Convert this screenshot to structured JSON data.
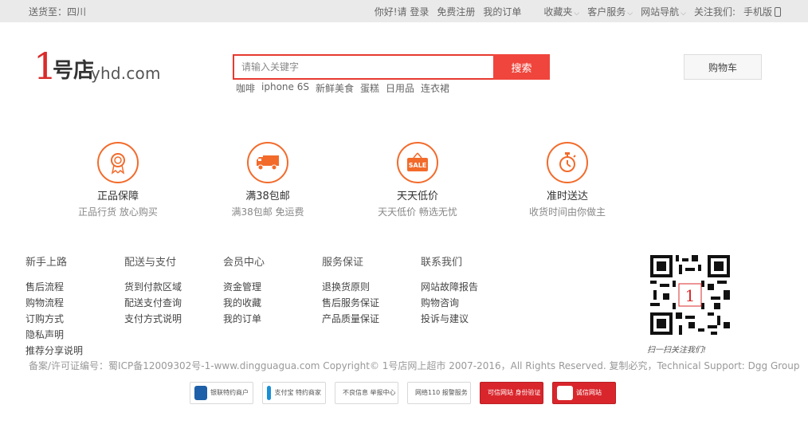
{
  "topbar": {
    "location": "送货至：四川",
    "greeting": "你好!请",
    "login": "登录",
    "register": "免费注册",
    "my_orders": "我的订单",
    "favorites": "收藏夹",
    "customer_service": "客户服务",
    "site_nav": "网站导航",
    "follow_us": "关注我们:",
    "mobile": "手机版"
  },
  "header": {
    "logo_digit": "1",
    "logo_char": "号店",
    "logo_domain": "yhd.com",
    "search_placeholder": "请输入关键字",
    "search_button": "搜索",
    "hotwords": [
      "咖啡",
      "iphone 6S",
      "新鲜美食",
      "蛋糕",
      "日用品",
      "连衣裙"
    ],
    "cart_label": "购物车"
  },
  "services": [
    {
      "title": "正品保障",
      "sub": "正品行货 放心购买",
      "icon": "certificate-icon"
    },
    {
      "title": "满38包邮",
      "sub": "满38包邮 免运费",
      "icon": "truck-icon"
    },
    {
      "title": "天天低价",
      "sub": "天天低价 畅选无忧",
      "icon": "sale-tag-icon",
      "icon_text": "SALE"
    },
    {
      "title": "准时送达",
      "sub": "收货时间由你做主",
      "icon": "stopwatch-icon"
    }
  ],
  "footer_columns": [
    {
      "head": "新手上路",
      "links": [
        "售后流程",
        "购物流程",
        "订购方式",
        "隐私声明",
        "推荐分享说明"
      ]
    },
    {
      "head": "配送与支付",
      "links": [
        "货到付款区域",
        "配送支付查询",
        "支付方式说明"
      ]
    },
    {
      "head": "会员中心",
      "links": [
        "资金管理",
        "我的收藏",
        "我的订单"
      ]
    },
    {
      "head": "服务保证",
      "links": [
        "退换货原则",
        "售后服务保证",
        "产品质量保证"
      ]
    },
    {
      "head": "联系我们",
      "links": [
        "网站故障报告",
        "购物咨询",
        "投诉与建议"
      ]
    }
  ],
  "qr_caption": "扫一扫关注我们!",
  "copyright": "备案/许可证编号：蜀ICP备12009302号-1-www.dingguagua.com Copyright© 1号店网上超市 2007-2016，All Rights Reserved. 复制必究，Technical Support: Dgg Group",
  "badges": [
    {
      "label": "银联特约商户",
      "icon": "unionpay-icon",
      "color": "#1d5fa8"
    },
    {
      "label": "支付宝 特约商家",
      "icon": "alipay-icon",
      "color": "#1a8fd6"
    },
    {
      "label": "不良信息 举报中心",
      "icon": "report-center-icon",
      "color": "#d92b2b"
    },
    {
      "label": "网络110 报警服务",
      "icon": "police-110-icon",
      "color": "#2a5a9a"
    },
    {
      "label": "可信网站 身份验证",
      "icon": "trusted-site-icon",
      "color": "#d9262c"
    },
    {
      "label": "诚信网站",
      "icon": "integrity-site-icon",
      "color": "#d9262c"
    }
  ]
}
